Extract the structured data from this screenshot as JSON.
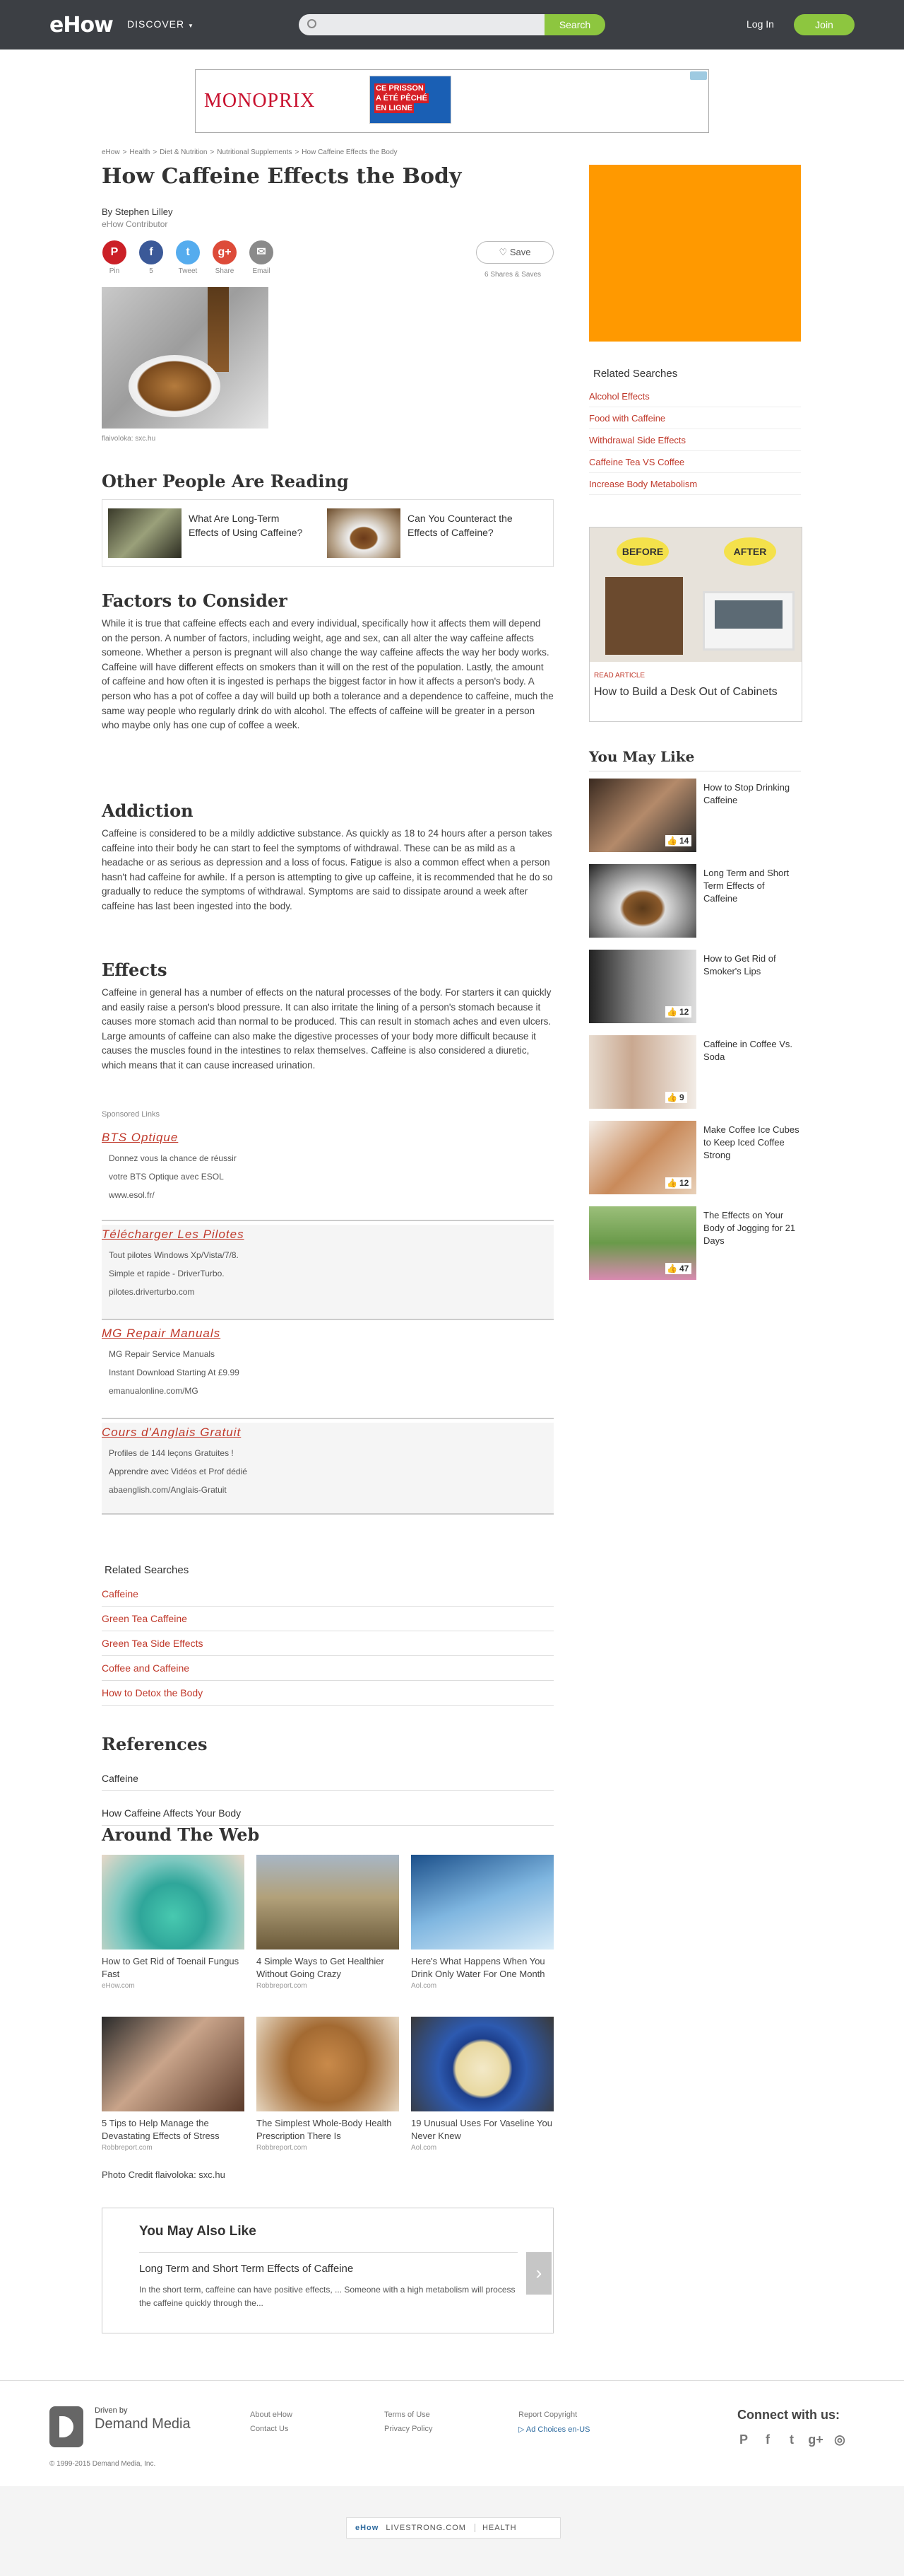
{
  "header": {
    "logo": "eHow",
    "discover": "DISCOVER",
    "search_button": "Search",
    "login": "Log In",
    "join": "Join"
  },
  "top_ad": {
    "brand": "MONOPRIX",
    "promo_line1": "CE PRISSON",
    "promo_line2": "A ÉTÉ PÊCHÉ",
    "promo_line3": "EN LIGNE"
  },
  "breadcrumb": [
    "eHow",
    ">",
    "Health",
    ">",
    "Diet & Nutrition",
    ">",
    "Nutritional Supplements",
    ">",
    "How Caffeine Effects the Body"
  ],
  "article": {
    "title": "How Caffeine Effects the Body",
    "author": "By Stephen Lilley",
    "role": "eHow Contributor",
    "share": [
      {
        "icon": "P",
        "label": "Pin",
        "color": "#cb2027"
      },
      {
        "icon": "f",
        "label": "5",
        "color": "#3b5998"
      },
      {
        "icon": "t",
        "label": "Tweet",
        "color": "#55acee"
      },
      {
        "icon": "g+",
        "label": "Share",
        "color": "#dd4b39"
      },
      {
        "icon": "✉",
        "label": "Email",
        "color": "#8a8a8a"
      }
    ],
    "save": "Save",
    "saves_count": "6 Shares & Saves",
    "image_caption": "flaivoloka: sxc.hu"
  },
  "other_reading": {
    "heading": "Other People Are Reading",
    "items": [
      {
        "title": "What Are Long-Term Effects of Using Caffeine?"
      },
      {
        "title": "Can You Counteract the Effects of Caffeine?"
      }
    ]
  },
  "sections": [
    {
      "heading": "Factors to Consider",
      "text": "While it is true that caffeine effects each and every individual, specifically how it affects them will depend on the person. A number of factors, including weight, age and sex, can all alter the way caffeine affects someone. Whether a person is pregnant will also change the way caffeine affects the way her body works. Caffeine will have different effects on smokers than it will on the rest of the population. Lastly, the amount of caffeine and how often it is ingested is perhaps the biggest factor in how it affects a person's body. A person who has a pot of coffee a day will build up both a tolerance and a dependence to caffeine, much the same way people who regularly drink do with alcohol. The effects of caffeine will be greater in a person who maybe only has one cup of coffee a week."
    },
    {
      "heading": "Addiction",
      "text": "Caffeine is considered to be a mildly addictive substance. As quickly as 18 to 24 hours after a person takes caffeine into their body he can start to feel the symptoms of withdrawal. These can be as mild as a headache or as serious as depression and a loss of focus. Fatigue is also a common effect when a person hasn't had caffeine for awhile. If a person is attempting to give up caffeine, it is recommended that he do so gradually to reduce the symptoms of withdrawal. Symptoms are said to dissipate around a week after caffeine has last been ingested into the body."
    },
    {
      "heading": "Effects",
      "text": "Caffeine in general has a number of effects on the natural processes of the body. For starters it can quickly and easily raise a person's blood pressure. It can also irritate the lining of a person's stomach because it causes more stomach acid than normal to be produced. This can result in stomach aches and even ulcers. Large amounts of caffeine can also make the digestive processes of your body more difficult because it causes the muscles found in the intestines to relax themselves. Caffeine is also considered a diuretic, which means that it can cause increased urination."
    }
  ],
  "sponsored": {
    "label": "Sponsored Links",
    "ads": [
      {
        "title": "BTS Optique",
        "lines": [
          "Donnez vous la chance de réussir",
          "votre BTS Optique avec ESOL",
          "www.esol.fr/"
        ]
      },
      {
        "title": "Télécharger Les Pilotes",
        "lines": [
          "Tout pilotes Windows Xp/Vista/7/8.",
          "Simple et rapide - DriverTurbo.",
          "pilotes.driverturbo.com"
        ]
      },
      {
        "title": "MG Repair Manuals",
        "lines": [
          "MG Repair Service Manuals",
          "Instant Download Starting At £9.99",
          "emanualonline.com/MG"
        ]
      },
      {
        "title": "Cours d'Anglais Gratuit",
        "lines": [
          "Profiles de 144 leçons Gratuites !",
          "Apprendre avec Vidéos et Prof dédié",
          "abaenglish.com/Anglais-Gratuit"
        ]
      }
    ]
  },
  "related_main": {
    "heading": "Related Searches",
    "items": [
      "Caffeine",
      "Green Tea Caffeine",
      "Green Tea Side Effects",
      "Coffee and Caffeine",
      "How to Detox the Body"
    ]
  },
  "references": {
    "heading": "References",
    "items": [
      "Caffeine",
      "How Caffeine Affects Your Body"
    ]
  },
  "around_web": {
    "heading": "Around The Web",
    "items": [
      {
        "title": "How to Get Rid of Toenail Fungus Fast",
        "source": "eHow.com"
      },
      {
        "title": "4 Simple Ways to Get Healthier Without Going Crazy",
        "source": "Robbreport.com"
      },
      {
        "title": "Here's What Happens When You Drink Only Water For One Month",
        "source": "Aol.com"
      },
      {
        "title": "5 Tips to Help Manage the Devastating Effects of Stress",
        "source": "Robbreport.com"
      },
      {
        "title": "The Simplest Whole-Body Health Prescription There Is",
        "source": "Robbreport.com"
      },
      {
        "title": "19 Unusual Uses For Vaseline You Never Knew",
        "source": "Aol.com"
      }
    ]
  },
  "photo_credit": "Photo Credit flaivoloka: sxc.hu",
  "you_may_also_like": {
    "heading": "You May Also Like",
    "title": "Long Term and Short Term Effects of Caffeine",
    "desc": "In the short term, caffeine can have positive effects, ... Someone with a high metabolism will process the caffeine quickly through the...",
    "arrow": "›"
  },
  "sidebar": {
    "related": {
      "heading": "Related Searches",
      "items": [
        "Alcohol Effects",
        "Food with Caffeine",
        "Withdrawal Side Effects",
        "Caffeine Tea VS Coffee",
        "Increase Body Metabolism"
      ]
    },
    "promo": {
      "before": "BEFORE",
      "after": "AFTER",
      "label": "READ ARTICLE",
      "title": "How to Build a Desk Out of Cabinets"
    },
    "you_may_like": {
      "heading": "You May Like",
      "items": [
        {
          "title": "How to Stop Drinking Caffeine",
          "likes": "14"
        },
        {
          "title": "Long Term and Short Term Effects of Caffeine",
          "likes": ""
        },
        {
          "title": "How to Get Rid of Smoker's Lips",
          "likes": "12"
        },
        {
          "title": "Caffeine in Coffee Vs. Soda",
          "likes": "9"
        },
        {
          "title": "Make Coffee Ice Cubes to Keep Iced Coffee Strong",
          "likes": "12"
        },
        {
          "title": "The Effects on Your Body of Jogging for 21 Days",
          "likes": "47"
        }
      ]
    }
  },
  "footer": {
    "driven_by": "Driven by",
    "demand_media": "Demand Media",
    "copyright": "© 1999-2015 Demand Media, Inc.",
    "links": [
      "About eHow",
      "Contact Us",
      "Terms of Use",
      "Privacy Policy",
      "Report Copyright",
      "Ad Choices en-US"
    ],
    "connect": "Connect with us:",
    "social": [
      "P",
      "f",
      "t",
      "g+",
      "◎"
    ]
  },
  "bottom_bar": {
    "ehow": "eHow",
    "livestrong": "LIVESTRONG.COM",
    "health": "HEALTH"
  }
}
